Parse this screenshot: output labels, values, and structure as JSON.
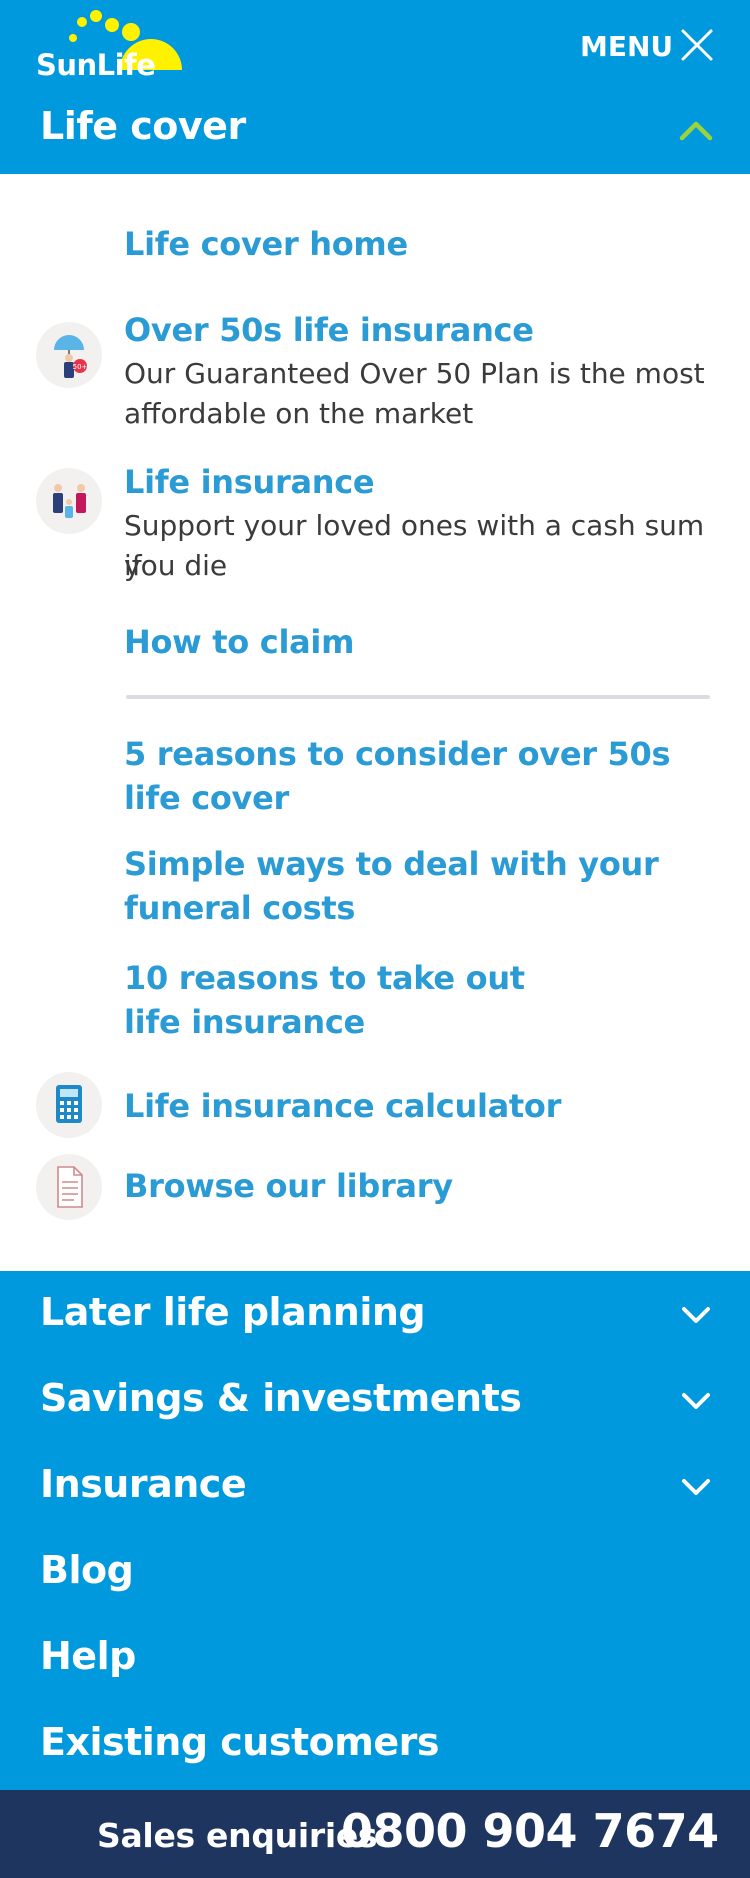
{
  "header": {
    "logo_text": "SunLife",
    "menu_label": "MENU",
    "section_title": "Life cover"
  },
  "panel": {
    "home_link": "Life cover home",
    "items": [
      {
        "title": "Over 50s life insurance",
        "desc_line1": "Our Guaranteed Over 50 Plan is the most",
        "desc_line2": "affordable on the market",
        "icon": "umbrella-person-icon"
      },
      {
        "title": "Life insurance",
        "desc_line1": "Support your loved ones with a cash sum if",
        "desc_line2": "you die",
        "icon": "family-icon"
      }
    ],
    "how_to_claim": "How to claim",
    "articles": [
      {
        "line1": "5 reasons to consider over 50s",
        "line2": "life cover"
      },
      {
        "line1": "Simple ways to deal with your",
        "line2": "funeral costs"
      },
      {
        "line1": "10 reasons to take out",
        "line2": "life insurance"
      }
    ],
    "calculator": "Life insurance calculator",
    "library": "Browse our library"
  },
  "nav": {
    "items": [
      "Later life planning",
      "Savings & investments",
      "Insurance",
      "Blog",
      "Help",
      "Existing customers"
    ]
  },
  "footer": {
    "label": "Sales enquiries",
    "phone": "0800 904 7674"
  },
  "colors": {
    "brand_blue": "#0099dd",
    "link_blue": "#2a9bd4",
    "footer_navy": "#1e3560",
    "accent_green": "#9ad43a",
    "sun_yellow": "#fff200"
  }
}
